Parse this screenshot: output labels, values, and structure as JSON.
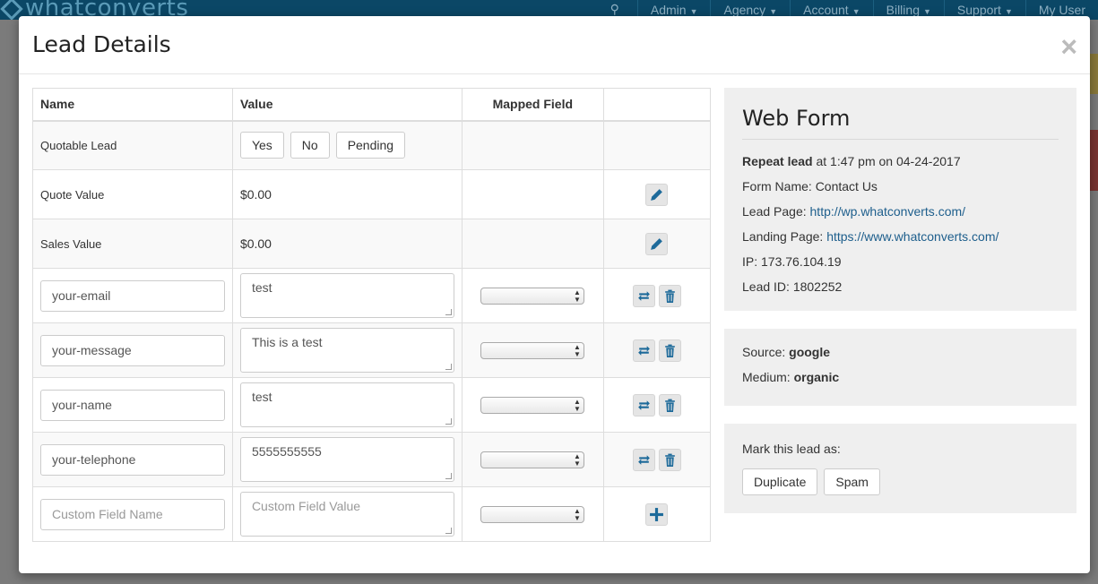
{
  "app": {
    "logo_text": "whatconverts",
    "nav": [
      "Admin",
      "Agency",
      "Account",
      "Billing",
      "Support",
      "My User"
    ]
  },
  "modal": {
    "title": "Lead Details",
    "close": "×"
  },
  "table": {
    "headers": [
      "Name",
      "Value",
      "Mapped Field",
      ""
    ],
    "quotable_label": "Quotable Lead",
    "quotable_options": [
      "Yes",
      "No",
      "Pending"
    ],
    "quote_value_label": "Quote Value",
    "quote_value": "$0.00",
    "sales_value_label": "Sales Value",
    "sales_value": "$0.00",
    "fields": [
      {
        "name": "your-email",
        "value": "test"
      },
      {
        "name": "your-message",
        "value": "This is a test"
      },
      {
        "name": "your-name",
        "value": "test"
      },
      {
        "name": "your-telephone",
        "value": "5555555555"
      }
    ],
    "new_field": {
      "name_placeholder": "Custom Field Name",
      "value_placeholder": "Custom Field Value"
    }
  },
  "webform": {
    "title": "Web Form",
    "repeat_label": "Repeat lead",
    "repeat_time": " at 1:47 pm on 04-24-2017",
    "form_name_label": "Form Name: ",
    "form_name": "Contact Us",
    "lead_page_label": "Lead Page: ",
    "lead_page": "http://wp.whatconverts.com/",
    "landing_page_label": "Landing Page: ",
    "landing_page": "https://www.whatconverts.com/",
    "ip_label": "IP: ",
    "ip": "173.76.104.19",
    "lead_id_label": "Lead ID: ",
    "lead_id": "1802252"
  },
  "source": {
    "source_label": "Source: ",
    "source": "google",
    "medium_label": "Medium: ",
    "medium": "organic"
  },
  "mark": {
    "label": "Mark this lead as:",
    "duplicate": "Duplicate",
    "spam": "Spam"
  },
  "colors": {
    "nav_bg": "#0b4766",
    "link": "#1d5e8c",
    "icon_blue": "#1d6a9a",
    "panel_bg": "#efefef"
  }
}
